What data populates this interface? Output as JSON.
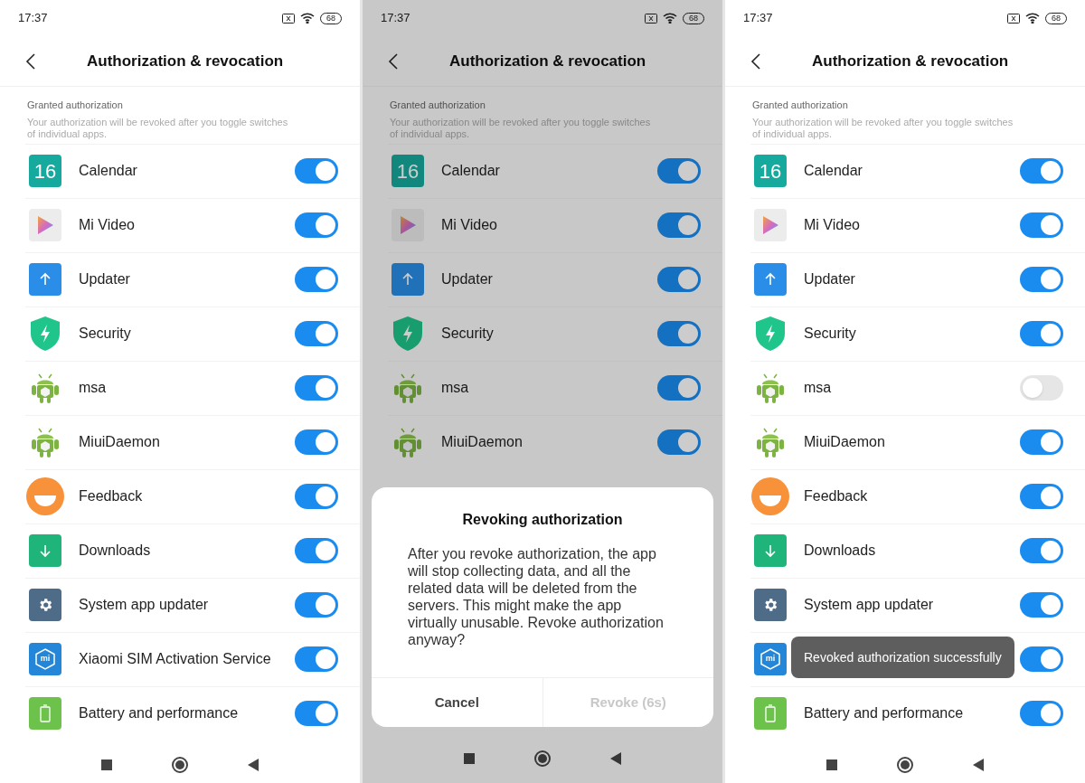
{
  "screens": [
    {
      "status": {
        "time": "17:37",
        "battery": "68"
      },
      "title": "Authorization & revocation",
      "section": {
        "label": "Granted authorization",
        "description": "Your authorization will be revoked after you toggle switches of individual apps."
      },
      "dimmed": false,
      "apps": [
        {
          "kind": "calendar",
          "icon_text": "16",
          "name": "Calendar",
          "on": true
        },
        {
          "kind": "video",
          "name": "Mi Video",
          "on": true
        },
        {
          "kind": "updater",
          "name": "Updater",
          "on": true
        },
        {
          "kind": "security",
          "name": "Security",
          "on": true
        },
        {
          "kind": "android",
          "name": "msa",
          "on": true
        },
        {
          "kind": "android",
          "name": "MiuiDaemon",
          "on": true
        },
        {
          "kind": "feedback",
          "name": "Feedback",
          "on": true
        },
        {
          "kind": "downloads",
          "name": "Downloads",
          "on": true
        },
        {
          "kind": "gear",
          "name": "System app updater",
          "on": true
        },
        {
          "kind": "mi",
          "icon_text": "mi",
          "name": "Xiaomi SIM Activation Service",
          "on": true
        },
        {
          "kind": "battery",
          "name": "Battery and performance",
          "on": true
        }
      ]
    },
    {
      "status": {
        "time": "17:37",
        "battery": "68"
      },
      "title": "Authorization & revocation",
      "section": {
        "label": "Granted authorization",
        "description": "Your authorization will be revoked after you toggle switches of individual apps."
      },
      "dimmed": true,
      "apps": [
        {
          "kind": "calendar",
          "icon_text": "16",
          "name": "Calendar",
          "on": true
        },
        {
          "kind": "video",
          "name": "Mi Video",
          "on": true
        },
        {
          "kind": "updater",
          "name": "Updater",
          "on": true
        },
        {
          "kind": "security",
          "name": "Security",
          "on": true
        },
        {
          "kind": "android",
          "name": "msa",
          "on": true
        },
        {
          "kind": "android",
          "name": "MiuiDaemon",
          "on": true
        }
      ],
      "dialog": {
        "title": "Revoking authorization",
        "message": "After you revoke authorization, the app will stop collecting data, and all the related data will be deleted from the servers. This might make the app virtually unusable. Revoke authorization anyway?",
        "buttons": [
          {
            "label": "Cancel",
            "disabled": false
          },
          {
            "label": "Revoke (6s)",
            "disabled": true
          }
        ]
      }
    },
    {
      "status": {
        "time": "17:37",
        "battery": "68"
      },
      "title": "Authorization & revocation",
      "section": {
        "label": "Granted authorization",
        "description": "Your authorization will be revoked after you toggle switches of individual apps."
      },
      "dimmed": false,
      "apps": [
        {
          "kind": "calendar",
          "icon_text": "16",
          "name": "Calendar",
          "on": true
        },
        {
          "kind": "video",
          "name": "Mi Video",
          "on": true
        },
        {
          "kind": "updater",
          "name": "Updater",
          "on": true
        },
        {
          "kind": "security",
          "name": "Security",
          "on": true
        },
        {
          "kind": "android",
          "name": "msa",
          "on": false
        },
        {
          "kind": "android",
          "name": "MiuiDaemon",
          "on": true
        },
        {
          "kind": "feedback",
          "name": "Feedback",
          "on": true
        },
        {
          "kind": "downloads",
          "name": "Downloads",
          "on": true
        },
        {
          "kind": "gear",
          "name": "System app updater",
          "on": true
        },
        {
          "kind": "mi",
          "icon_text": "mi",
          "on": true
        },
        {
          "kind": "battery",
          "name": "Battery and performance",
          "on": true
        }
      ],
      "toast": "Revoked authorization successfully"
    }
  ]
}
